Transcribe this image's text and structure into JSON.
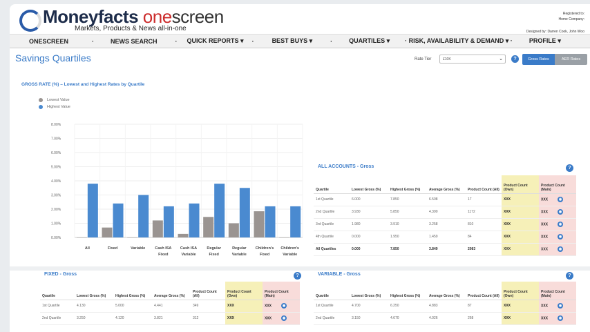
{
  "logo": {
    "brand": "Moneyfacts",
    "one": "one",
    "screen": "screen",
    "tagline": "Markets, Products & News all-in-one"
  },
  "registration": {
    "registered_to": "Registered to:",
    "company": "Home Company:",
    "designed_by": "Designed by: Darren Cook, John Woo"
  },
  "nav": [
    {
      "label": "ONESCREEN"
    },
    {
      "label": "·"
    },
    {
      "label": "NEWS SEARCH"
    },
    {
      "label": "·"
    },
    {
      "label": "QUICK REPORTS ▾"
    },
    {
      "label": "·"
    },
    {
      "label": "BEST BUYS ▾"
    },
    {
      "label": "·"
    },
    {
      "label": "QUARTILES ▾"
    },
    {
      "label": "· RISK, AVAILABILITY & DEMAND ▾ ·"
    },
    {
      "label": "PROFILE ▾"
    }
  ],
  "page": {
    "title": "Savings Quartiles",
    "rate_tier_label": "Rate Tier",
    "rate_tier_value": "£10K",
    "gross_rates_btn": "Gross Rates",
    "aer_rates_btn": "AER Rates",
    "info_glyph": "?"
  },
  "chart_data": {
    "type": "bar",
    "title": "GROSS RATE (%) – Lowest and Highest Rates by Quartile",
    "categories": [
      "All",
      "Fixed",
      "Variable",
      "Cash ISA Fixed",
      "Cash ISA Variable",
      "Regular Fixed",
      "Regular Variable",
      "Children's Fixed",
      "Children's Variable"
    ],
    "category_lines": [
      [
        "All"
      ],
      [
        "Fixed"
      ],
      [
        "Variable"
      ],
      [
        "Cash ISA",
        "Fixed"
      ],
      [
        "Cash ISA",
        "Variable"
      ],
      [
        "Regular",
        "Fixed"
      ],
      [
        "Regular",
        "Variable"
      ],
      [
        "Children's",
        "Fixed"
      ],
      [
        "Children's",
        "Variable"
      ]
    ],
    "series": [
      {
        "name": "Lowest Value",
        "color": "#9a9491",
        "values": [
          0.0,
          0.7,
          0.0,
          1.2,
          0.25,
          1.45,
          1.0,
          1.85,
          0.0
        ]
      },
      {
        "name": "Highest Value",
        "color": "#4a8ad0",
        "values": [
          3.8,
          2.4,
          3.0,
          2.2,
          2.4,
          3.8,
          3.5,
          2.2,
          2.2
        ]
      }
    ],
    "yticks": [
      "0.00%",
      "1.00%",
      "2.00%",
      "3.00%",
      "4.00%",
      "5.00%",
      "6.00%",
      "7.00%",
      "8.00%"
    ],
    "ylim": [
      0,
      8
    ],
    "grid": true,
    "legend_position": "top-left"
  },
  "tables": {
    "all": {
      "title": "ALL ACCOUNTS - Gross",
      "headers": [
        "Quartile",
        "Lowest Gross (%)",
        "Highest Gross (%)",
        "Average Gross (%)",
        "Product Count (All)",
        "Product Count (Own)",
        "Product Count (Main)"
      ],
      "rows": [
        [
          "1st Quartile",
          "6.000",
          "7.850",
          "6.508",
          "17",
          "XXX",
          "XXX"
        ],
        [
          "2nd Quartile",
          "3.930",
          "5.850",
          "4.390",
          "1172",
          "XXX",
          "XXX"
        ],
        [
          "3rd Quartile",
          "1.980",
          "3.910",
          "3.258",
          "810",
          "XXX",
          "XXX"
        ],
        [
          "4th Quartile",
          "0.000",
          "1.950",
          "1.459",
          "84",
          "XXX",
          "XXX"
        ],
        [
          "All Quartiles",
          "0.000",
          "7.850",
          "3.849",
          "2083",
          "XXX",
          "XXX"
        ]
      ]
    },
    "fixed": {
      "title": "FIXED - Gross",
      "headers": [
        "Quartile",
        "Lowest Gross (%)",
        "Highest Gross (%)",
        "Average Gross (%)",
        "Product Count (All)",
        "Product Count (Own)",
        "Product Count (Main)"
      ],
      "rows": [
        [
          "1st Quartile",
          "4.130",
          "5.000",
          "4.441",
          "349",
          "XXX",
          "XXX"
        ],
        [
          "2nd Quartile",
          "3.250",
          "4.120",
          "3.821",
          "312",
          "XXX",
          "XXX"
        ]
      ]
    },
    "variable": {
      "title": "VARIABLE - Gross",
      "headers": [
        "Quartile",
        "Lowest Gross (%)",
        "Highest Gross (%)",
        "Average Gross (%)",
        "Product Count (All)",
        "Product Count (Own)",
        "Product Count (Main)"
      ],
      "rows": [
        [
          "1st Quartile",
          "4.700",
          "6.250",
          "4.883",
          "87",
          "XXX",
          "XXX"
        ],
        [
          "2nd Quartile",
          "3.150",
          "4.670",
          "4.026",
          "268",
          "XXX",
          "XXX"
        ]
      ]
    }
  }
}
